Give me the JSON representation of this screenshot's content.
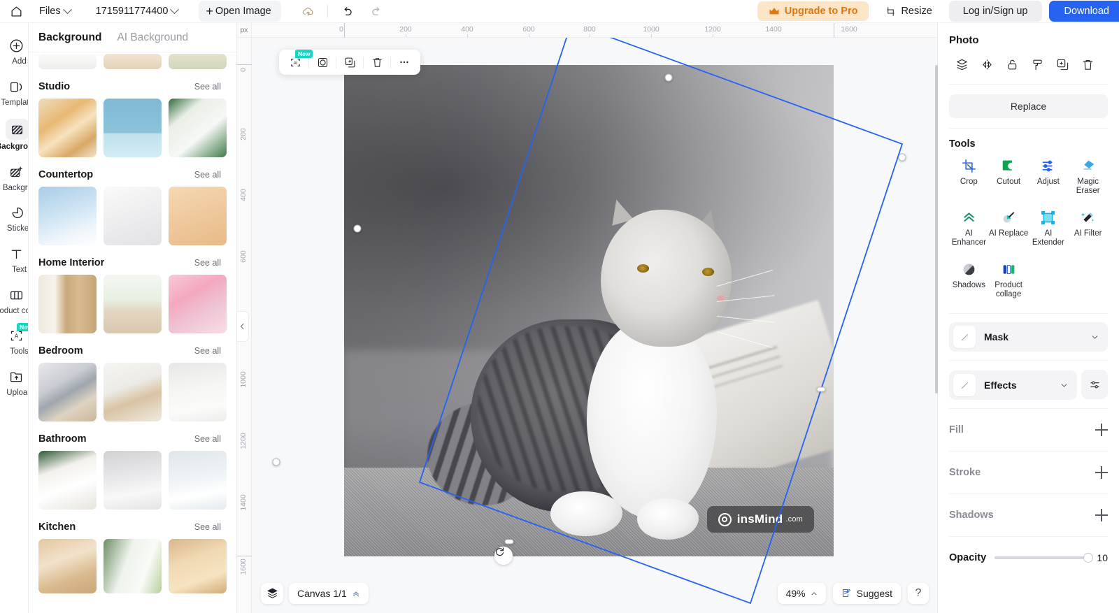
{
  "header": {
    "home_icon": "home-icon",
    "files_label": "Files",
    "filename": "1715911774400",
    "open_image_label": "Open Image",
    "cloud_icon": "cloud-sync-icon",
    "undo_icon": "undo-icon",
    "redo_icon": "redo-icon",
    "upgrade_label": "Upgrade to Pro",
    "crown_icon": "crown-icon",
    "resize_label": "Resize",
    "resize_icon": "resize-icon",
    "login_label": "Log in/Sign up",
    "download_label": "Download"
  },
  "rail": [
    {
      "icon": "plus-circle-icon",
      "label": "Add",
      "active": false,
      "badge": ""
    },
    {
      "icon": "templates-icon",
      "label": "Templates",
      "active": false,
      "badge": ""
    },
    {
      "icon": "background-icon",
      "label": "Background",
      "active": true,
      "badge": ""
    },
    {
      "icon": "ai-background-icon",
      "label": "AI Background",
      "active": false,
      "badge": ""
    },
    {
      "icon": "sticker-icon",
      "label": "Sticker",
      "active": false,
      "badge": ""
    },
    {
      "icon": "text-icon",
      "label": "Text",
      "active": false,
      "badge": ""
    },
    {
      "icon": "product-collage-icon",
      "label": "Product collage",
      "active": false,
      "badge": ""
    },
    {
      "icon": "ai-tools-icon",
      "label": "Tools",
      "active": false,
      "badge": "New"
    },
    {
      "icon": "upload-icon",
      "label": "Upload",
      "active": false,
      "badge": ""
    }
  ],
  "panel": {
    "tabs": [
      {
        "label": "Background",
        "active": true
      },
      {
        "label": "AI Background",
        "active": false
      }
    ],
    "see_all_label": "See all",
    "groups": [
      {
        "title": "Studio",
        "see_all": "See all"
      },
      {
        "title": "Countertop",
        "see_all": "See all"
      },
      {
        "title": "Home Interior",
        "see_all": "See all"
      },
      {
        "title": "Bedroom",
        "see_all": "See all"
      },
      {
        "title": "Bathroom",
        "see_all": "See all"
      },
      {
        "title": "Kitchen",
        "see_all": "See all"
      }
    ]
  },
  "canvas": {
    "unit_label": "px",
    "h_ticks": [
      "0",
      "200",
      "400",
      "600",
      "800",
      "1000",
      "1200",
      "1400",
      "1600"
    ],
    "v_ticks": [
      "0",
      "200",
      "400",
      "600",
      "800",
      "1000",
      "1200",
      "1400",
      "1600"
    ],
    "watermark_name": "insMind",
    "watermark_tld": ".com",
    "rotate_icon": "rotate-icon"
  },
  "element_toolbar": [
    {
      "icon": "ai-select-icon",
      "badge": "New",
      "name": "ai-select-button"
    },
    {
      "icon": "mask-circle-icon",
      "badge": "",
      "name": "mask-button"
    },
    {
      "icon": "duplicate-icon",
      "badge": "",
      "name": "duplicate-button"
    },
    {
      "icon": "trash-icon",
      "badge": "",
      "name": "delete-button"
    },
    {
      "icon": "more-dots-icon",
      "badge": "",
      "name": "more-button"
    }
  ],
  "bottombar": {
    "layers_icon": "layers-icon",
    "canvas_label": "Canvas 1/1",
    "zoom_label": "49%",
    "suggest_label": "Suggest",
    "suggest_icon": "suggest-icon",
    "help_label": "?"
  },
  "right": {
    "title": "Photo",
    "icons": [
      {
        "icon": "layers-arrange-icon",
        "name": "arrange-icon"
      },
      {
        "icon": "flip-icon",
        "name": "flip-icon"
      },
      {
        "icon": "unlock-icon",
        "name": "lock-icon"
      },
      {
        "icon": "paint-roller-icon",
        "name": "paint-format-icon"
      },
      {
        "icon": "duplicate-icon",
        "name": "duplicate-icon"
      },
      {
        "icon": "trash-icon",
        "name": "delete-icon"
      }
    ],
    "replace_label": "Replace",
    "tools_title": "Tools",
    "tools": [
      {
        "label": "Crop",
        "icon": "crop-icon"
      },
      {
        "label": "Cutout",
        "icon": "cutout-icon"
      },
      {
        "label": "Adjust",
        "icon": "adjust-icon"
      },
      {
        "label": "Magic Eraser",
        "icon": "magic-eraser-icon"
      },
      {
        "label": "AI Enhancer",
        "icon": "ai-enhancer-icon"
      },
      {
        "label": "AI Replace",
        "icon": "ai-replace-icon"
      },
      {
        "label": "AI Extender",
        "icon": "ai-extender-icon"
      },
      {
        "label": "AI Filter",
        "icon": "ai-filter-icon"
      },
      {
        "label": "Shadows",
        "icon": "shadows-icon"
      },
      {
        "label": "Product collage",
        "icon": "product-collage-icon"
      }
    ],
    "mask_label": "Mask",
    "effects_label": "Effects",
    "fill_label": "Fill",
    "stroke_label": "Stroke",
    "shadows_label": "Shadows",
    "opacity_label": "Opacity",
    "opacity_value": "10"
  },
  "colors": {
    "accent_blue": "#2563f0",
    "pro_orange": "#e1760e",
    "pro_bg": "#fde6c8",
    "selection": "#2563f0",
    "badge_teal": "#17d6c0"
  }
}
